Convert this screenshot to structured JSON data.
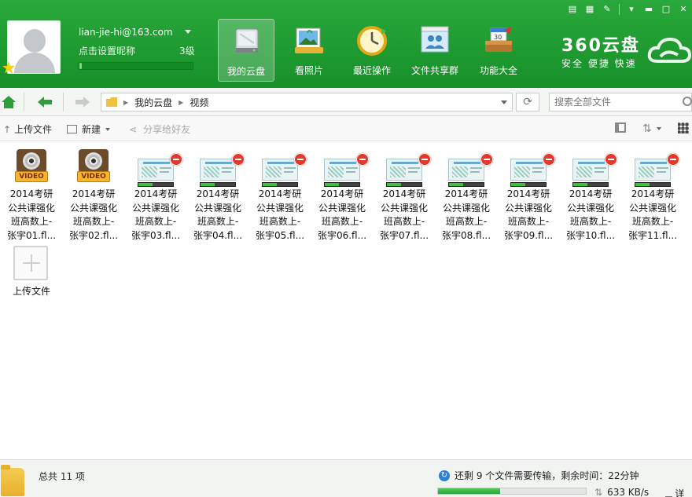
{
  "window_controls": [
    "menu-icon",
    "skin-icon",
    "settings-icon",
    "minimize-icon",
    "maximize-icon",
    "close-icon"
  ],
  "user": {
    "account": "lian-jie-hi@163.com",
    "nickname_prompt": "点击设置昵称",
    "level": "3级",
    "level_progress": 0.02,
    "level_badge": "3"
  },
  "nav": [
    {
      "label": "我的云盘",
      "icon": "hard-drive-icon",
      "active": true
    },
    {
      "label": "看照片",
      "icon": "photos-icon",
      "active": false
    },
    {
      "label": "最近操作",
      "icon": "clock-icon",
      "active": false
    },
    {
      "label": "文件共享群",
      "icon": "share-group-icon",
      "active": false
    },
    {
      "label": "功能大全",
      "icon": "toolbox-icon",
      "active": false
    }
  ],
  "brand": {
    "name": "360云盘",
    "tagline": "安全 便捷 快速"
  },
  "address": {
    "crumbs": [
      "我的云盘",
      "视频"
    ]
  },
  "search": {
    "placeholder": "搜索全部文件"
  },
  "commands": {
    "upload": "上传文件",
    "new": "新建",
    "share": "分享给好友"
  },
  "files": [
    {
      "name": "2014考研\n公共课强化\n班高数上-\n张宇01.fl...",
      "type": "video"
    },
    {
      "name": "2014考研\n公共课强化\n班高数上-\n张宇02.fl...",
      "type": "video"
    },
    {
      "name": "2014考研\n公共课强化\n班高数上-\n张宇03.fl...",
      "type": "uploading",
      "progress": 0.4
    },
    {
      "name": "2014考研\n公共课强化\n班高数上-\n张宇04.fl...",
      "type": "uploading",
      "progress": 0.4
    },
    {
      "name": "2014考研\n公共课强化\n班高数上-\n张宇05.fl...",
      "type": "uploading",
      "progress": 0.4
    },
    {
      "name": "2014考研\n公共课强化\n班高数上-\n张宇06.fl...",
      "type": "uploading",
      "progress": 0.4
    },
    {
      "name": "2014考研\n公共课强化\n班高数上-\n张宇07.fl...",
      "type": "uploading",
      "progress": 0.4
    },
    {
      "name": "2014考研\n公共课强化\n班高数上-\n张宇08.fl...",
      "type": "uploading",
      "progress": 0.4
    },
    {
      "name": "2014考研\n公共课强化\n班高数上-\n张宇09.fl...",
      "type": "uploading",
      "progress": 0.4
    },
    {
      "name": "2014考研\n公共课强化\n班高数上-\n张宇10.fl...",
      "type": "uploading",
      "progress": 0.4
    },
    {
      "name": "2014考研\n公共课强化\n班高数上-\n张宇11.fl...",
      "type": "uploading",
      "progress": 0.4
    }
  ],
  "video_tag": "VIDEO",
  "upload_tile_label": "上传文件",
  "status": {
    "total": "总共 11 项",
    "transfer": "还剩 9 个文件需要传输，剩余时间：22分钟",
    "transfer_progress": 0.42,
    "speed": "633 KB/s",
    "detail": "详细"
  },
  "colors": {
    "header_green": "#1e9a30",
    "accent_green": "#2aa53a",
    "cancel_red": "#e23a2a"
  }
}
